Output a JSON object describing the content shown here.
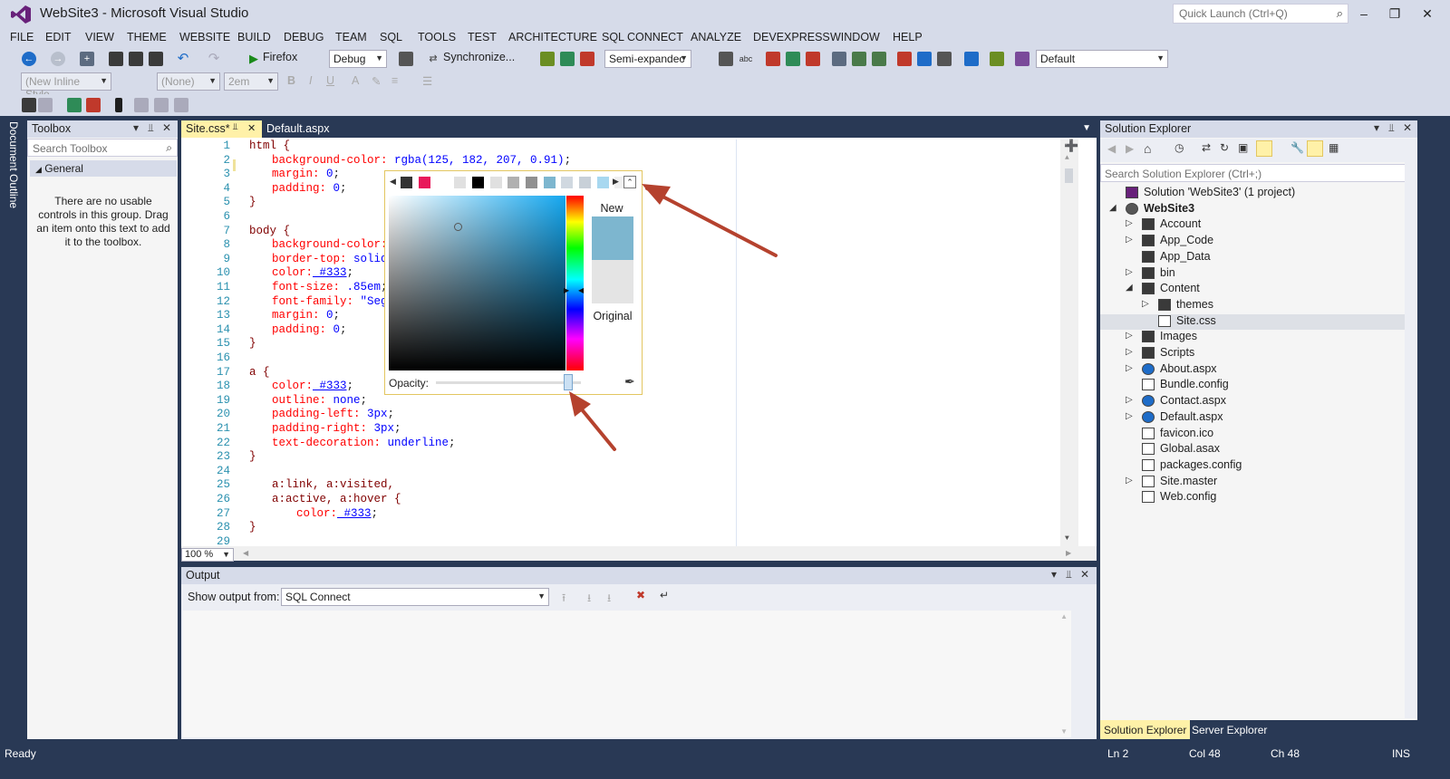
{
  "window": {
    "title": "WebSite3 - Microsoft Visual Studio",
    "quick_launch_placeholder": "Quick Launch (Ctrl+Q)"
  },
  "menu": [
    "FILE",
    "EDIT",
    "VIEW",
    "THEME",
    "WEBSITE",
    "BUILD",
    "DEBUG",
    "TEAM",
    "SQL",
    "TOOLS",
    "TEST",
    "ARCHITECTURE",
    "SQL CONNECT",
    "ANALYZE",
    "DEVEXPRESS",
    "WINDOW",
    "HELP"
  ],
  "toolbar": {
    "run_target": "Firefox",
    "config": "Debug",
    "sync_label": "Synchronize...",
    "outline_mode": "Semi-expandec",
    "layout": "Default",
    "style_combo": "(New Inline Style",
    "font_combo": "(None)",
    "size_combo": "2em"
  },
  "document_outline_label": "Document Outline",
  "toolbox": {
    "title": "Toolbox",
    "search_placeholder": "Search Toolbox",
    "group": "General",
    "empty_text": "There are no usable controls in this group. Drag an item onto this text to add it to the toolbox."
  },
  "editor": {
    "tabs": [
      "Site.css*",
      "Default.aspx"
    ],
    "zoom": "100 %",
    "lines": [
      {
        "n": "1",
        "sel": "html {"
      },
      {
        "n": "2",
        "prop": "background-color:",
        "val": " rgba(125, 182, 207, 0.91)",
        "tail": ";"
      },
      {
        "n": "3",
        "prop": "margin:",
        "val": " 0",
        "tail": ";"
      },
      {
        "n": "4",
        "prop": "padding:",
        "val": " 0",
        "tail": ";"
      },
      {
        "n": "5",
        "sel": "}"
      },
      {
        "n": "6"
      },
      {
        "n": "7",
        "sel": "body {"
      },
      {
        "n": "8",
        "prop": "background-color:"
      },
      {
        "n": "9",
        "prop": "border-top:",
        "val": " solid"
      },
      {
        "n": "10",
        "prop": "color:",
        "val": " #333",
        "tail": ";"
      },
      {
        "n": "11",
        "prop": "font-size:",
        "val": " .85em",
        "tail": ";"
      },
      {
        "n": "12",
        "prop": "font-family:",
        "val": " \"Sego"
      },
      {
        "n": "13",
        "prop": "margin:",
        "val": " 0",
        "tail": ";"
      },
      {
        "n": "14",
        "prop": "padding:",
        "val": " 0",
        "tail": ";"
      },
      {
        "n": "15",
        "sel": "}"
      },
      {
        "n": "16"
      },
      {
        "n": "17",
        "sel": "a {"
      },
      {
        "n": "18",
        "prop": "color:",
        "val": " #333",
        "tail": ";"
      },
      {
        "n": "19",
        "prop": "outline:",
        "val": " none",
        "tail": ";"
      },
      {
        "n": "20",
        "prop": "padding-left:",
        "val": " 3px",
        "tail": ";"
      },
      {
        "n": "21",
        "prop": "padding-right:",
        "val": " 3px",
        "tail": ";"
      },
      {
        "n": "22",
        "prop": "text-decoration:",
        "val": " underline",
        "tail": ";"
      },
      {
        "n": "23",
        "sel": "}"
      },
      {
        "n": "24"
      },
      {
        "n": "25",
        "sel": "a:link, a:visited,"
      },
      {
        "n": "26",
        "sel": "a:active, a:hover {"
      },
      {
        "n": "27",
        "prop": "color:",
        "val": " #333",
        "tail": ";"
      },
      {
        "n": "28",
        "sel": "}"
      },
      {
        "n": "29"
      }
    ]
  },
  "color_picker": {
    "new_label": "New",
    "original_label": "Original",
    "opacity_label": "Opacity:",
    "opacity": 0.91,
    "new_color": "#7db6cf",
    "swatches": [
      "#333333",
      "#e8195a",
      "#ffffff",
      "#e0e0e0",
      "#000000",
      "#e0e0e0",
      "#b0b0b0",
      "#909090",
      "#7db6cf",
      "#d0d8e0",
      "#c8d0d8",
      "#a8d8f0",
      "#f0f0f0"
    ]
  },
  "output": {
    "title": "Output",
    "show_from_label": "Show output from:",
    "source": "SQL Connect"
  },
  "solution_explorer": {
    "title": "Solution Explorer",
    "search_placeholder": "Search Solution Explorer (Ctrl+;)",
    "tree": [
      {
        "label": "Solution 'WebSite3' (1 project)",
        "depth": 0,
        "exp": "",
        "icon": "solution"
      },
      {
        "label": "WebSite3",
        "depth": 0,
        "exp": "◢",
        "icon": "globe",
        "bold": true
      },
      {
        "label": "Account",
        "depth": 1,
        "exp": "▷",
        "icon": "folder"
      },
      {
        "label": "App_Code",
        "depth": 1,
        "exp": "▷",
        "icon": "folder"
      },
      {
        "label": "App_Data",
        "depth": 1,
        "exp": "",
        "icon": "folder"
      },
      {
        "label": "bin",
        "depth": 1,
        "exp": "▷",
        "icon": "folder"
      },
      {
        "label": "Content",
        "depth": 1,
        "exp": "◢",
        "icon": "folder"
      },
      {
        "label": "themes",
        "depth": 2,
        "exp": "▷",
        "icon": "folder"
      },
      {
        "label": "Site.css",
        "depth": 2,
        "exp": "",
        "icon": "file",
        "selected": true
      },
      {
        "label": "Images",
        "depth": 1,
        "exp": "▷",
        "icon": "folder"
      },
      {
        "label": "Scripts",
        "depth": 1,
        "exp": "▷",
        "icon": "folder"
      },
      {
        "label": "About.aspx",
        "depth": 1,
        "exp": "▷",
        "icon": "web"
      },
      {
        "label": "Bundle.config",
        "depth": 1,
        "exp": "",
        "icon": "config"
      },
      {
        "label": "Contact.aspx",
        "depth": 1,
        "exp": "▷",
        "icon": "web"
      },
      {
        "label": "Default.aspx",
        "depth": 1,
        "exp": "▷",
        "icon": "web"
      },
      {
        "label": "favicon.ico",
        "depth": 1,
        "exp": "",
        "icon": "file"
      },
      {
        "label": "Global.asax",
        "depth": 1,
        "exp": "",
        "icon": "file"
      },
      {
        "label": "packages.config",
        "depth": 1,
        "exp": "",
        "icon": "config"
      },
      {
        "label": "Site.master",
        "depth": 1,
        "exp": "▷",
        "icon": "file"
      },
      {
        "label": "Web.config",
        "depth": 1,
        "exp": "",
        "icon": "config"
      }
    ],
    "tabs": [
      "Solution Explorer",
      "Server Explorer"
    ]
  },
  "status": {
    "state": "Ready",
    "ln": "Ln 2",
    "col": "Col 48",
    "ch": "Ch 48",
    "mode": "INS"
  }
}
